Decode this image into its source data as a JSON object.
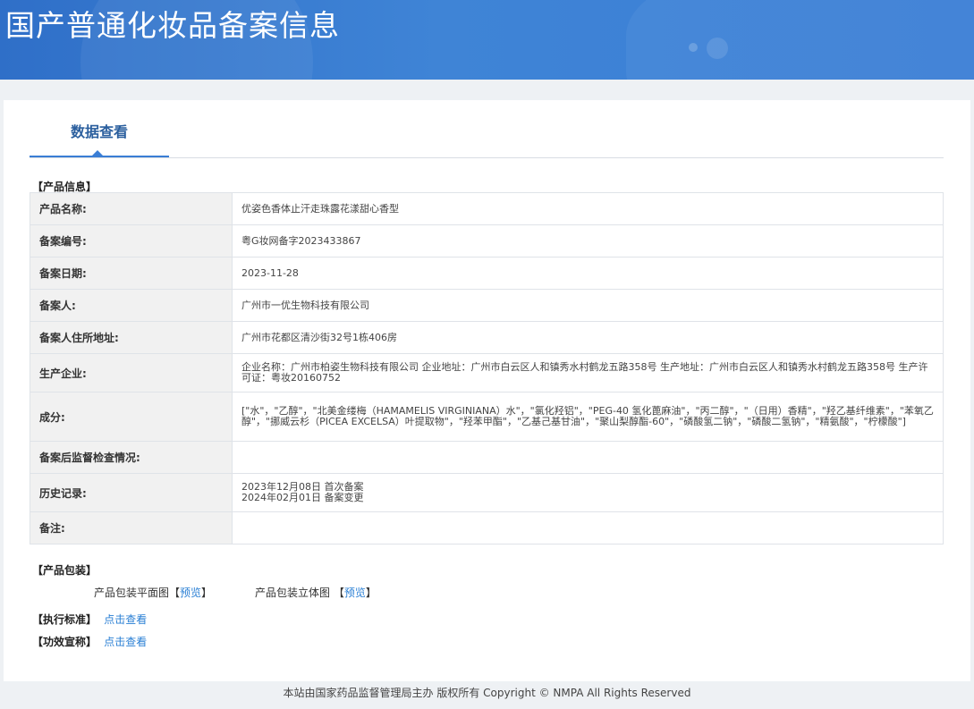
{
  "header": {
    "title": "国产普通化妆品备案信息"
  },
  "tabs": [
    {
      "label": "数据查看"
    }
  ],
  "product_section": {
    "label": "【产品信息】"
  },
  "rows": [
    {
      "key": "产品名称:",
      "value": "优姿色香体止汗走珠露花漾甜心香型"
    },
    {
      "key": "备案编号:",
      "value": "粤G妆网备字2023433867"
    },
    {
      "key": "备案日期:",
      "value": "2023-11-28"
    },
    {
      "key": "备案人:",
      "value": "广州市一优生物科技有限公司"
    },
    {
      "key": "备案人住所地址:",
      "value": "广州市花都区清沙街32号1栋406房"
    },
    {
      "key": "生产企业:",
      "value": "企业名称：广州市柏姿生物科技有限公司 企业地址：广州市白云区人和镇秀水村鹤龙五路358号 生产地址：广州市白云区人和镇秀水村鹤龙五路358号 生产许可证：粤妆20160752"
    },
    {
      "key": "成分:",
      "value": "[\"水\"，\"乙醇\"，\"北美金缕梅（HAMAMELIS VIRGINIANA）水\"，\"氯化羟铝\"，\"PEG-40 氢化蓖麻油\"，\"丙二醇\"，\"（日用）香精\"，\"羟乙基纤维素\"，\"苯氧乙醇\"，\"挪威云杉（PICEA EXCELSA）叶提取物\"，\"羟苯甲酯\"，\"乙基己基甘油\"，\"聚山梨醇酯-60\"，\"磷酸氢二钠\"，\"磷酸二氢钠\"，\"精氨酸\"，\"柠檬酸\"]"
    },
    {
      "key": "备案后监督检查情况:",
      "value": ""
    },
    {
      "key": "历史记录:",
      "value_lines": [
        "2023年12月08日 首次备案",
        "2024年02月01日 备案变更"
      ]
    },
    {
      "key": "备注:",
      "value": ""
    }
  ],
  "packaging": {
    "label": "【产品包装】",
    "flat_label": "产品包装平面图【",
    "flat_link": "预览",
    "flat_close": "】",
    "solid_label": "产品包装立体图 【",
    "solid_link": "预览",
    "solid_close": "】"
  },
  "standard": {
    "label": "【执行标准】",
    "link": "点击查看"
  },
  "efficacy": {
    "label": "【功效宣称】",
    "link": "点击查看"
  },
  "footer": {
    "text": "本站由国家药品监督管理局主办 版权所有 Copyright © NMPA All Rights Reserved"
  }
}
